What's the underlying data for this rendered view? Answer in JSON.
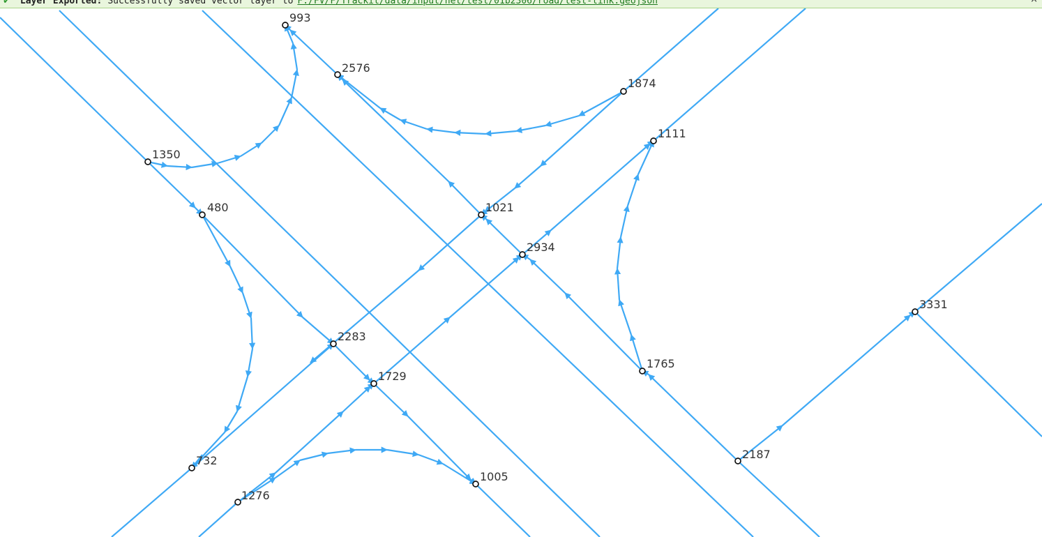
{
  "message_bar": {
    "title": "Layer Exported:",
    "text": "Successfully saved vector layer to",
    "link": "F:/FV/F/Trackit/data/input/net/test/01b2306/road/test-link.geojson",
    "close": "×"
  },
  "colors": {
    "link": "#3fa9f5",
    "node_fill": "#ffffff",
    "node_stroke": "#111111",
    "label": "#333333"
  },
  "nodes": [
    {
      "id": "993",
      "label": "993"
    },
    {
      "id": "2576",
      "label": "2576"
    },
    {
      "id": "1874",
      "label": "1874"
    },
    {
      "id": "1111",
      "label": "1111"
    },
    {
      "id": "1350",
      "label": "1350"
    },
    {
      "id": "480",
      "label": "480"
    },
    {
      "id": "1021",
      "label": "1021"
    },
    {
      "id": "2934",
      "label": "2934"
    },
    {
      "id": "3331",
      "label": "3331"
    },
    {
      "id": "2283",
      "label": "2283"
    },
    {
      "id": "1765",
      "label": "1765"
    },
    {
      "id": "1729",
      "label": "1729"
    },
    {
      "id": "2187",
      "label": "2187"
    },
    {
      "id": "732",
      "label": "732"
    },
    {
      "id": "1005",
      "label": "1005"
    },
    {
      "id": "1276",
      "label": "1276"
    }
  ]
}
